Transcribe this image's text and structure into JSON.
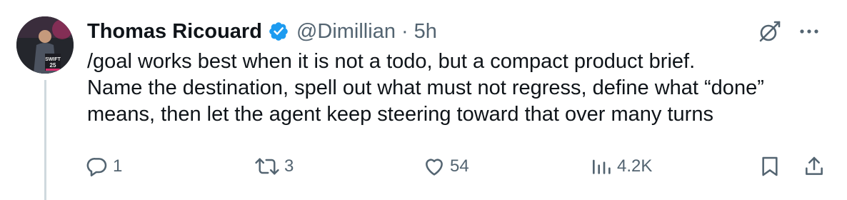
{
  "author": {
    "name": "Thomas Ricouard",
    "handle": "@Dimillian",
    "separator": "·",
    "time": "5h",
    "avatar_badge_top": "SWIFT",
    "avatar_badge_bottom": "25"
  },
  "tweet": {
    "lines": [
      "/goal works best when it is not a todo, but a compact product brief.",
      "Name the destination, spell out what must not regress, define what “done”",
      "means, then let the agent keep steering toward that over many turns"
    ]
  },
  "actions": {
    "replies": "1",
    "reposts": "3",
    "likes": "54",
    "views": "4.2K"
  },
  "icons": {
    "verified": "verified-badge-icon",
    "grok": "grok-icon",
    "more": "more-icon",
    "reply": "reply-icon",
    "repost": "repost-icon",
    "like": "heart-icon",
    "views": "views-icon",
    "bookmark": "bookmark-icon",
    "share": "share-icon"
  },
  "colors": {
    "verified": "#1d9bf0",
    "text": "#0f1419",
    "muted": "#536471",
    "thread_line": "#cfd9de"
  }
}
